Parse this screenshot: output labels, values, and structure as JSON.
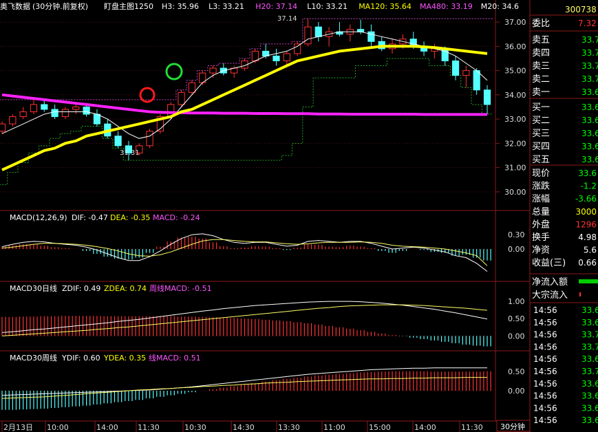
{
  "header": {
    "title": "奥飞数据",
    "period": "(30分钟.前复权)",
    "main_label": "盯盘主图1250",
    "items": [
      {
        "label": "H3:",
        "value": "35.96",
        "color": "#ffffff"
      },
      {
        "label": "L3:",
        "value": "33.21",
        "color": "#ffffff"
      },
      {
        "label": "H20:",
        "value": "37.14",
        "color": "#ff55ff"
      },
      {
        "label": "L10:",
        "value": "33.21",
        "color": "#ffffff"
      },
      {
        "label": "MA120:",
        "value": "35.64",
        "color": "#ffff00"
      },
      {
        "label": "MA480:",
        "value": "33.19",
        "color": "#ff55ff"
      },
      {
        "label": "M20:",
        "value": "34.6",
        "color": "#ffffff"
      }
    ]
  },
  "annotations": {
    "high": "37.14",
    "low": "31.31"
  },
  "macd_panel": {
    "title": "MACD(12,26,9)",
    "dif": "DIF: -0.47",
    "dea": "DEA: -0.35",
    "macd": "MACD: -0.24"
  },
  "daily_panel": {
    "title": "MACD30日线",
    "zdif": "ZDIF: 0.49",
    "zdea": "ZDEA: 0.74",
    "macd": "周线MACD: -0.51"
  },
  "weekly_panel": {
    "title": "MACD30周线",
    "ydif": "YDIF: 0.60",
    "ydea": "YDEA: 0.35",
    "macd": "线MACD: 0.51"
  },
  "price_ticks": [
    "37.00",
    "36.00",
    "35.00",
    "34.00",
    "33.00",
    "32.00",
    "31.00",
    "30.00"
  ],
  "macd_ticks": [
    "0.30",
    "0.00"
  ],
  "daily_ticks": [
    "1.00",
    "0.50",
    "0.00"
  ],
  "weekly_ticks": [
    "0.50",
    "0.00"
  ],
  "time_labels": [
    "2月13日",
    "10:00",
    "14:00",
    "11:30",
    "10:30",
    "14:30",
    "13:30",
    "11:00",
    "15:00",
    "14:00",
    "11:30"
  ],
  "period_button": "30分钟",
  "side": {
    "code": "300738",
    "weibi": {
      "label": "委比",
      "value": "7.32"
    },
    "sell": [
      {
        "label": "卖五",
        "value": "33.7"
      },
      {
        "label": "卖四",
        "value": "33.7"
      },
      {
        "label": "卖三",
        "value": "33.7"
      },
      {
        "label": "卖二",
        "value": "33.7"
      },
      {
        "label": "卖一",
        "value": "33.6"
      }
    ],
    "buy": [
      {
        "label": "买一",
        "value": "33.6"
      },
      {
        "label": "买二",
        "value": "33.6"
      },
      {
        "label": "买三",
        "value": "33.6"
      },
      {
        "label": "买四",
        "value": "33.6"
      },
      {
        "label": "买五",
        "value": "33.6"
      }
    ],
    "stats": [
      {
        "label": "现价",
        "value": "33.6",
        "color": "#00ff00"
      },
      {
        "label": "涨跌",
        "value": "-1.2",
        "color": "#00ff00"
      },
      {
        "label": "涨幅",
        "value": "-3.66",
        "color": "#00ff00"
      },
      {
        "label": "总量",
        "value": "3000",
        "color": "#ffff00"
      },
      {
        "label": "外盘",
        "value": "1296",
        "color": "#ff3333"
      },
      {
        "label": "换手",
        "value": "4.98",
        "color": "#ffffff"
      },
      {
        "label": "净资",
        "value": "5.6",
        "color": "#ffffff"
      },
      {
        "label": "收益(三)",
        "value": "0.66",
        "color": "#ffffff"
      }
    ],
    "flow": [
      {
        "label": "净流入额"
      },
      {
        "label": "大宗流入"
      }
    ],
    "ticks": [
      {
        "time": "14:56",
        "price": "33.6"
      },
      {
        "time": "14:56",
        "price": "33.6"
      },
      {
        "time": "14:56",
        "price": "33.7"
      },
      {
        "time": "14:56",
        "price": "33.7"
      },
      {
        "time": "14:56",
        "price": "33.6"
      },
      {
        "time": "14:56",
        "price": "33.7"
      },
      {
        "time": "14:56",
        "price": "33.6"
      },
      {
        "time": "14:56",
        "price": "33.6"
      },
      {
        "time": "14:56",
        "price": "33.6"
      },
      {
        "time": "14:56",
        "price": "33.6"
      }
    ]
  },
  "chart_data": {
    "type": "line",
    "ylim": [
      29.4,
      37.4
    ],
    "candles": [
      [
        32.5,
        32.9,
        32.4,
        32.8
      ],
      [
        32.8,
        33.2,
        32.7,
        33.1
      ],
      [
        33.1,
        33.5,
        33.0,
        33.3
      ],
      [
        33.3,
        33.8,
        33.2,
        33.6
      ],
      [
        33.6,
        33.8,
        33.3,
        33.4
      ],
      [
        33.4,
        33.6,
        33.0,
        33.1
      ],
      [
        33.1,
        33.5,
        33.0,
        33.4
      ],
      [
        33.4,
        33.7,
        33.2,
        33.5
      ],
      [
        33.5,
        33.6,
        33.1,
        33.2
      ],
      [
        33.2,
        33.4,
        32.7,
        32.8
      ],
      [
        32.8,
        33.0,
        32.2,
        32.3
      ],
      [
        32.3,
        32.5,
        31.8,
        31.9
      ],
      [
        31.9,
        32.1,
        31.3,
        31.6
      ],
      [
        31.6,
        32.0,
        31.5,
        31.9
      ],
      [
        31.9,
        32.6,
        31.8,
        32.5
      ],
      [
        32.5,
        33.2,
        32.4,
        33.1
      ],
      [
        33.1,
        33.7,
        33.0,
        33.6
      ],
      [
        33.6,
        34.2,
        33.5,
        34.1
      ],
      [
        34.1,
        34.6,
        34.0,
        34.5
      ],
      [
        34.5,
        35.0,
        34.4,
        34.9
      ],
      [
        34.9,
        35.2,
        34.7,
        35.1
      ],
      [
        35.1,
        35.3,
        34.8,
        34.9
      ],
      [
        34.9,
        35.2,
        34.7,
        35.1
      ],
      [
        35.1,
        35.5,
        35.0,
        35.4
      ],
      [
        35.4,
        35.9,
        35.3,
        35.8
      ],
      [
        35.8,
        36.1,
        35.5,
        35.6
      ],
      [
        35.6,
        35.9,
        35.2,
        35.4
      ],
      [
        35.4,
        35.8,
        35.2,
        35.7
      ],
      [
        35.7,
        36.2,
        35.6,
        36.1
      ],
      [
        36.1,
        37.14,
        36.0,
        36.8
      ],
      [
        36.8,
        37.0,
        36.2,
        36.4
      ],
      [
        36.4,
        36.8,
        36.0,
        36.6
      ],
      [
        36.6,
        37.0,
        36.4,
        36.5
      ],
      [
        36.5,
        36.9,
        36.2,
        36.7
      ],
      [
        36.7,
        37.1,
        36.5,
        36.6
      ],
      [
        36.6,
        36.9,
        36.0,
        36.2
      ],
      [
        36.2,
        36.4,
        35.8,
        35.9
      ],
      [
        35.9,
        36.3,
        35.7,
        36.1
      ],
      [
        36.1,
        36.5,
        35.9,
        36.3
      ],
      [
        36.3,
        36.6,
        35.9,
        36.0
      ],
      [
        36.0,
        36.2,
        35.6,
        35.8
      ],
      [
        35.8,
        36.1,
        35.5,
        35.9
      ],
      [
        35.9,
        36.0,
        35.2,
        35.4
      ],
      [
        35.4,
        35.6,
        34.6,
        34.8
      ],
      [
        34.8,
        35.2,
        34.3,
        35.0
      ],
      [
        35.0,
        35.1,
        34.0,
        34.2
      ],
      [
        34.2,
        34.4,
        33.2,
        33.6
      ]
    ],
    "ma120": [
      30.9,
      31.1,
      31.3,
      31.5,
      31.7,
      31.8,
      32.0,
      32.1,
      32.3,
      32.4,
      32.5,
      32.6,
      32.7,
      32.8,
      32.9,
      33.0,
      33.1,
      33.3,
      33.4,
      33.6,
      33.8,
      34.0,
      34.2,
      34.4,
      34.6,
      34.8,
      35.0,
      35.2,
      35.4,
      35.5,
      35.6,
      35.7,
      35.8,
      35.85,
      35.9,
      35.95,
      36.0,
      36.0,
      36.0,
      36.0,
      35.98,
      35.95,
      35.9,
      35.85,
      35.8,
      35.75,
      35.7
    ],
    "ma480": [
      34.0,
      33.95,
      33.9,
      33.85,
      33.8,
      33.75,
      33.7,
      33.65,
      33.6,
      33.55,
      33.5,
      33.45,
      33.4,
      33.35,
      33.3,
      33.28,
      33.27,
      33.26,
      33.25,
      33.25,
      33.25,
      33.24,
      33.24,
      33.24,
      33.23,
      33.23,
      33.23,
      33.22,
      33.22,
      33.22,
      33.21,
      33.21,
      33.21,
      33.2,
      33.2,
      33.2,
      33.2,
      33.2,
      33.2,
      33.2,
      33.19,
      33.19,
      33.19,
      33.19,
      33.19,
      33.19,
      33.19
    ],
    "m20": [
      32.4,
      32.6,
      32.8,
      33.0,
      33.2,
      33.3,
      33.3,
      33.3,
      33.3,
      33.2,
      33.0,
      32.7,
      32.4,
      32.2,
      32.3,
      32.6,
      33.0,
      33.5,
      34.0,
      34.5,
      34.8,
      35.0,
      35.1,
      35.2,
      35.4,
      35.6,
      35.7,
      35.8,
      36.0,
      36.3,
      36.4,
      36.5,
      36.6,
      36.6,
      36.6,
      36.5,
      36.4,
      36.3,
      36.2,
      36.1,
      36.0,
      35.9,
      35.8,
      35.6,
      35.3,
      35.0,
      34.6
    ],
    "h20": [
      33.8,
      33.8,
      33.8,
      33.8,
      33.8,
      33.8,
      33.8,
      33.8,
      33.8,
      33.8,
      33.8,
      33.8,
      33.8,
      33.8,
      33.8,
      33.8,
      33.8,
      34.2,
      34.6,
      35.0,
      35.2,
      35.3,
      35.3,
      35.5,
      35.9,
      36.1,
      36.1,
      36.1,
      36.2,
      37.14,
      37.14,
      37.14,
      37.14,
      37.14,
      37.14,
      37.14,
      37.14,
      37.14,
      37.14,
      37.14,
      37.14,
      37.14,
      37.14,
      37.14,
      37.14,
      37.14,
      37.14
    ],
    "l10": [
      30.3,
      30.8,
      31.2,
      31.6,
      31.9,
      32.2,
      32.4,
      32.5,
      32.7,
      32.7,
      32.2,
      31.8,
      31.3,
      31.3,
      31.3,
      31.3,
      31.3,
      31.3,
      31.3,
      31.3,
      31.3,
      31.3,
      31.3,
      31.3,
      31.3,
      31.3,
      31.3,
      31.5,
      32.0,
      33.5,
      34.7,
      34.7,
      34.7,
      34.7,
      35.2,
      35.2,
      35.2,
      35.5,
      35.5,
      35.5,
      35.5,
      35.2,
      35.2,
      34.8,
      34.3,
      33.6,
      33.21
    ],
    "macd": {
      "ylim": [
        -0.62,
        0.52
      ],
      "hist": [
        0.05,
        0.08,
        0.1,
        0.1,
        0.07,
        0.04,
        0.02,
        0.0,
        -0.04,
        -0.1,
        -0.16,
        -0.2,
        -0.22,
        -0.18,
        -0.08,
        0.05,
        0.16,
        0.24,
        0.26,
        0.22,
        0.14,
        0.06,
        0.02,
        0.03,
        0.06,
        0.05,
        0.02,
        -0.02,
        0.03,
        0.1,
        0.09,
        0.05,
        0.04,
        0.07,
        0.05,
        0.02,
        -0.04,
        -0.08,
        -0.04,
        0.0,
        -0.02,
        -0.06,
        -0.08,
        -0.14,
        -0.12,
        -0.18,
        -0.24
      ],
      "dif": [
        0.05,
        0.1,
        0.14,
        0.16,
        0.15,
        0.12,
        0.1,
        0.08,
        0.04,
        -0.02,
        -0.1,
        -0.18,
        -0.24,
        -0.24,
        -0.16,
        -0.04,
        0.1,
        0.22,
        0.3,
        0.32,
        0.28,
        0.2,
        0.14,
        0.12,
        0.14,
        0.14,
        0.1,
        0.06,
        0.08,
        0.16,
        0.18,
        0.16,
        0.14,
        0.16,
        0.16,
        0.12,
        0.06,
        0.0,
        0.02,
        0.04,
        0.02,
        -0.02,
        -0.06,
        -0.14,
        -0.18,
        -0.3,
        -0.47
      ],
      "dea": [
        0.02,
        0.04,
        0.07,
        0.1,
        0.12,
        0.12,
        0.11,
        0.1,
        0.08,
        0.05,
        0.01,
        -0.04,
        -0.1,
        -0.14,
        -0.15,
        -0.12,
        -0.06,
        0.02,
        0.1,
        0.17,
        0.2,
        0.2,
        0.18,
        0.16,
        0.15,
        0.15,
        0.13,
        0.11,
        0.1,
        0.11,
        0.13,
        0.14,
        0.14,
        0.14,
        0.15,
        0.14,
        0.12,
        0.08,
        0.06,
        0.05,
        0.04,
        0.02,
        0.0,
        -0.04,
        -0.08,
        -0.14,
        -0.35
      ]
    },
    "daily": {
      "ylim": [
        -0.35,
        1.2
      ],
      "hist": [
        0.55,
        0.55,
        0.56,
        0.56,
        0.57,
        0.57,
        0.58,
        0.58,
        0.58,
        0.58,
        0.57,
        0.57,
        0.57,
        0.57,
        0.57,
        0.57,
        0.57,
        0.56,
        0.56,
        0.55,
        0.54,
        0.53,
        0.52,
        0.5,
        0.49,
        0.47,
        0.45,
        0.43,
        0.4,
        0.37,
        0.33,
        0.29,
        0.25,
        0.21,
        0.17,
        0.12,
        0.07,
        0.03,
        -0.01,
        -0.05,
        -0.09,
        -0.13,
        -0.17,
        -0.21,
        -0.25,
        -0.28,
        -0.3
      ],
      "zdif": [
        0.1,
        0.12,
        0.15,
        0.18,
        0.2,
        0.23,
        0.26,
        0.29,
        0.32,
        0.35,
        0.38,
        0.42,
        0.45,
        0.48,
        0.52,
        0.56,
        0.6,
        0.64,
        0.68,
        0.72,
        0.75,
        0.79,
        0.82,
        0.85,
        0.88,
        0.9,
        0.92,
        0.94,
        0.96,
        0.98,
        0.99,
        1.0,
        1.0,
        1.0,
        0.99,
        0.97,
        0.95,
        0.92,
        0.89,
        0.85,
        0.81,
        0.77,
        0.72,
        0.67,
        0.61,
        0.55,
        0.49
      ],
      "zdea": [
        0.0,
        0.02,
        0.04,
        0.06,
        0.08,
        0.1,
        0.12,
        0.14,
        0.16,
        0.19,
        0.21,
        0.24,
        0.26,
        0.29,
        0.32,
        0.35,
        0.38,
        0.41,
        0.44,
        0.47,
        0.5,
        0.53,
        0.56,
        0.59,
        0.62,
        0.65,
        0.68,
        0.71,
        0.74,
        0.77,
        0.8,
        0.82,
        0.85,
        0.87,
        0.88,
        0.89,
        0.9,
        0.9,
        0.9,
        0.89,
        0.88,
        0.86,
        0.84,
        0.82,
        0.8,
        0.77,
        0.74
      ]
    },
    "weekly": {
      "ylim": [
        -0.72,
        0.72
      ],
      "hist": [
        -0.5,
        -0.5,
        -0.49,
        -0.48,
        -0.47,
        -0.45,
        -0.43,
        -0.41,
        -0.39,
        -0.36,
        -0.33,
        -0.3,
        -0.27,
        -0.24,
        -0.2,
        -0.16,
        -0.12,
        -0.08,
        -0.04,
        0.0,
        0.04,
        0.08,
        0.12,
        0.16,
        0.2,
        0.24,
        0.28,
        0.31,
        0.34,
        0.37,
        0.4,
        0.42,
        0.44,
        0.46,
        0.48,
        0.49,
        0.5,
        0.51,
        0.51,
        0.51,
        0.51,
        0.5,
        0.5,
        0.5,
        0.5,
        0.5,
        0.51
      ],
      "ydif": [
        -0.12,
        -0.11,
        -0.1,
        -0.09,
        -0.08,
        -0.07,
        -0.06,
        -0.05,
        -0.04,
        -0.03,
        -0.02,
        -0.01,
        0.0,
        0.01,
        0.02,
        0.04,
        0.06,
        0.08,
        0.1,
        0.13,
        0.16,
        0.19,
        0.22,
        0.25,
        0.28,
        0.31,
        0.34,
        0.37,
        0.4,
        0.43,
        0.45,
        0.47,
        0.49,
        0.51,
        0.53,
        0.55,
        0.56,
        0.57,
        0.58,
        0.59,
        0.59,
        0.6,
        0.6,
        0.6,
        0.6,
        0.6,
        0.6
      ],
      "ydea": [
        -0.2,
        -0.19,
        -0.18,
        -0.17,
        -0.16,
        -0.14,
        -0.12,
        -0.1,
        -0.08,
        -0.06,
        -0.04,
        -0.02,
        0.0,
        0.02,
        0.03,
        0.05,
        0.06,
        0.08,
        0.09,
        0.11,
        0.12,
        0.14,
        0.15,
        0.17,
        0.18,
        0.2,
        0.21,
        0.22,
        0.24,
        0.25,
        0.26,
        0.27,
        0.28,
        0.29,
        0.3,
        0.31,
        0.31,
        0.32,
        0.32,
        0.33,
        0.33,
        0.34,
        0.34,
        0.34,
        0.35,
        0.35,
        0.35
      ]
    }
  }
}
